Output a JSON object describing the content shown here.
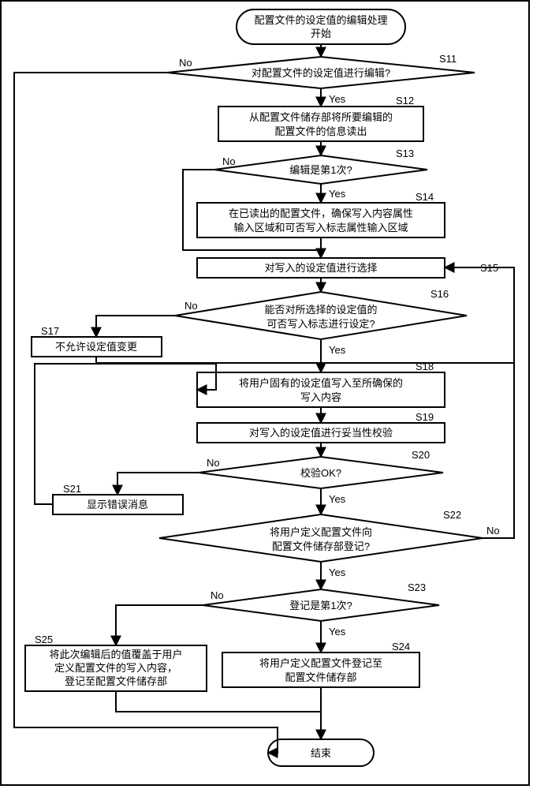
{
  "chart_data": {
    "type": "flowchart",
    "language": "zh-CN",
    "nodes": {
      "start": {
        "type": "terminator",
        "label": "配置文件的设定值的编辑处理\n开始"
      },
      "s11": {
        "type": "decision",
        "step": "S11",
        "label": "对配置文件的设定值进行编辑?",
        "yes": "s12",
        "no": "end"
      },
      "s12": {
        "type": "process",
        "step": "S12",
        "label": "从配置文件储存部将所要编辑的\n配置文件的信息读出"
      },
      "s13": {
        "type": "decision",
        "step": "S13",
        "label": "编辑是第1次?",
        "yes": "s14",
        "no": "s15"
      },
      "s14": {
        "type": "process",
        "step": "S14",
        "label": "在已读出的配置文件，确保写入内容属性\n输入区域和可否写入标志属性输入区域"
      },
      "s15": {
        "type": "process",
        "step": "S15",
        "label": "对写入的设定值进行选择"
      },
      "s16": {
        "type": "decision",
        "step": "S16",
        "label": "能否对所选择的设定值的\n可否写入标志进行设定?",
        "yes": "s18",
        "no": "s17"
      },
      "s17": {
        "type": "process",
        "step": "S17",
        "label": "不允许设定值变更",
        "next": "s15"
      },
      "s18": {
        "type": "process",
        "step": "S18",
        "label": "将用户固有的设定值写入至所确保的\n写入内容"
      },
      "s19": {
        "type": "process",
        "step": "S19",
        "label": "对写入的设定值进行妥当性校验"
      },
      "s20": {
        "type": "decision",
        "step": "S20",
        "label": "校验OK?",
        "yes": "s22",
        "no": "s21"
      },
      "s21": {
        "type": "process",
        "step": "S21",
        "label": "显示错误消息",
        "next": "s18"
      },
      "s22": {
        "type": "decision",
        "step": "S22",
        "label": "将用户定义配置文件向\n配置文件储存部登记?",
        "yes": "s23",
        "no": "s15"
      },
      "s23": {
        "type": "decision",
        "step": "S23",
        "label": "登记是第1次?",
        "yes": "s24",
        "no": "s25"
      },
      "s24": {
        "type": "process",
        "step": "S24",
        "label": "将用户定义配置文件登记至\n配置文件储存部",
        "next": "end"
      },
      "s25": {
        "type": "process",
        "step": "S25",
        "label": "将此次编辑后的值覆盖于用户\n定义配置文件的写入内容，\n登记至配置文件储存部",
        "next": "end"
      },
      "end": {
        "type": "terminator",
        "label": "结束"
      }
    },
    "edge_labels": {
      "yes": "Yes",
      "no": "No"
    }
  }
}
